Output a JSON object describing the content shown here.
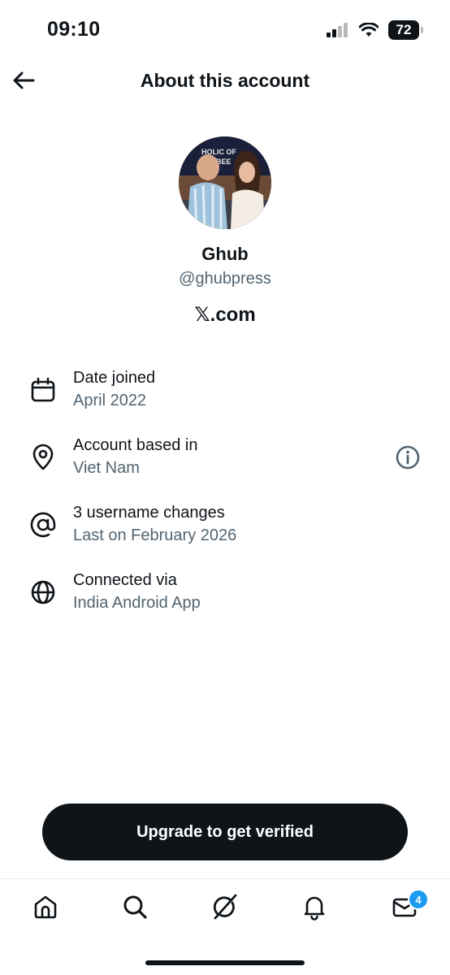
{
  "status_bar": {
    "time": "09:10",
    "battery": "72"
  },
  "header": {
    "title": "About this account"
  },
  "profile": {
    "name": "Ghub",
    "handle": "@ghubpress",
    "site": "𝕏.com"
  },
  "details": [
    {
      "icon": "calendar-icon",
      "title": "Date joined",
      "value": "April 2022"
    },
    {
      "icon": "location-pin-icon",
      "title": "Account based in",
      "value": "Viet Nam"
    },
    {
      "icon": "at-sign-icon",
      "title": "3 username changes",
      "value": "Last on February 2026"
    },
    {
      "icon": "globe-icon",
      "title": "Connected via",
      "value": "India Android App"
    }
  ],
  "upgrade_button": {
    "label": "Upgrade to get verified"
  },
  "tab_bar": {
    "tabs": [
      "home-icon",
      "search-icon",
      "grok-icon",
      "notifications-icon",
      "messages-icon"
    ],
    "messages_badge": "4"
  },
  "colors": {
    "primary_text": "#0f1419",
    "secondary_text": "#536471",
    "accent": "#1d9bf0"
  }
}
